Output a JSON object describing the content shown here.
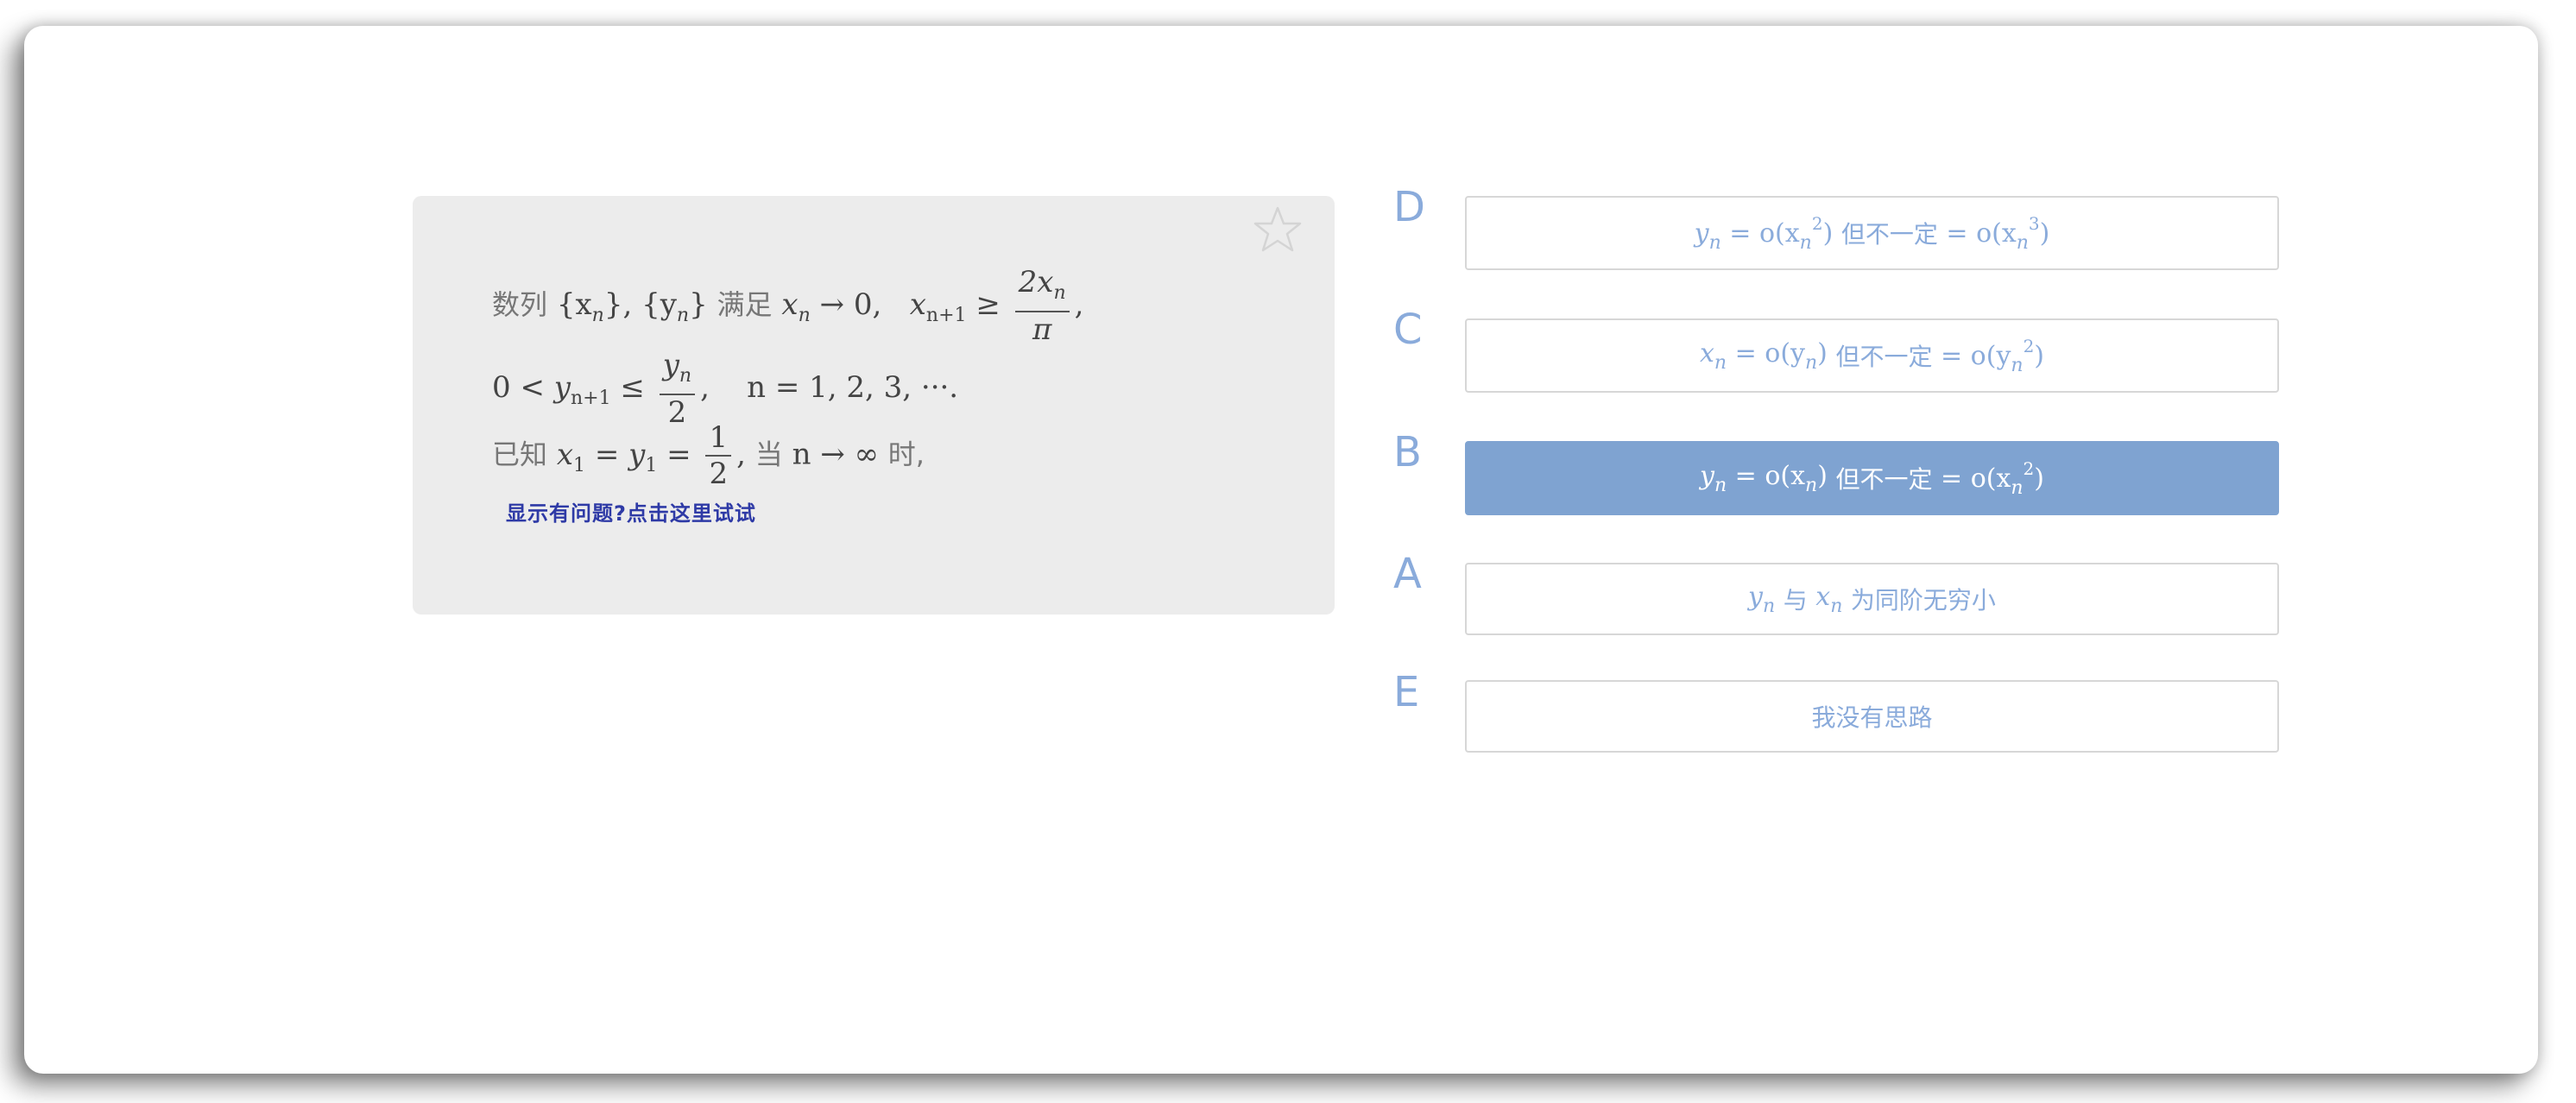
{
  "question": {
    "line1": {
      "p1": "数列",
      "xn_set": "{x",
      "n": "n",
      "close": "}",
      "comma": ",",
      "yn_set": "{y",
      "p2": "满足",
      "cond1": "x",
      "arrow0": "→ 0,",
      "cond2": "x",
      "n1": "n+1",
      "geq": "≥",
      "frac_num": "2x",
      "frac_den": "π",
      "tail": ","
    },
    "line2": {
      "zero_lt": "0 <",
      "y": "y",
      "n1": "n+1",
      "leq": "≤",
      "frac_num": "y",
      "frac_num_sub": "n",
      "frac_den": "2",
      "tail": ",",
      "n_range": "n = 1, 2, 3, ···."
    },
    "line3": {
      "p1": "已知",
      "x1": "x",
      "eq": "=",
      "y1": "y",
      "one": "1",
      "eq2": "=",
      "frac_num": "1",
      "frac_den": "2",
      "comma": ",",
      "p2": "当",
      "n_to_inf": "n → ∞",
      "p3": "时,"
    },
    "help_link": "显示有问题?点击这里试试"
  },
  "options": [
    {
      "letter": "D",
      "math_left": "y",
      "sub_left": "n",
      "eq": "= o(x",
      "sub_a": "n",
      "sup_a": "2",
      "close_a": ")",
      "mid": "但不一定",
      "eq2": "= o(x",
      "sub_b": "n",
      "sup_b": "3",
      "close_b": ")",
      "selected": false
    },
    {
      "letter": "C",
      "math_left": "x",
      "sub_left": "n",
      "eq": "= o(y",
      "sub_a": "n",
      "sup_a": "",
      "close_a": ")",
      "mid": "但不一定",
      "eq2": "= o(y",
      "sub_b": "n",
      "sup_b": "2",
      "close_b": ")",
      "selected": false
    },
    {
      "letter": "B",
      "math_left": "y",
      "sub_left": "n",
      "eq": "= o(x",
      "sub_a": "n",
      "sup_a": "",
      "close_a": ")",
      "mid": "但不一定",
      "eq2": "= o(x",
      "sub_b": "n",
      "sup_b": "2",
      "close_b": ")",
      "selected": true
    },
    {
      "letter": "A",
      "text_a": "y",
      "sub_a": "n",
      "mid": "与",
      "text_b": "x",
      "sub_b": "n",
      "tail": "为同阶无穷小",
      "selected": false
    },
    {
      "letter": "E",
      "text": "我没有思路",
      "selected": false
    }
  ],
  "colors": {
    "accent": "#7fa3d1",
    "letter": "#8aabdb",
    "link": "#2e3aa6",
    "card": "#ececec"
  },
  "icons": {
    "favorite": "star-outline-icon"
  }
}
